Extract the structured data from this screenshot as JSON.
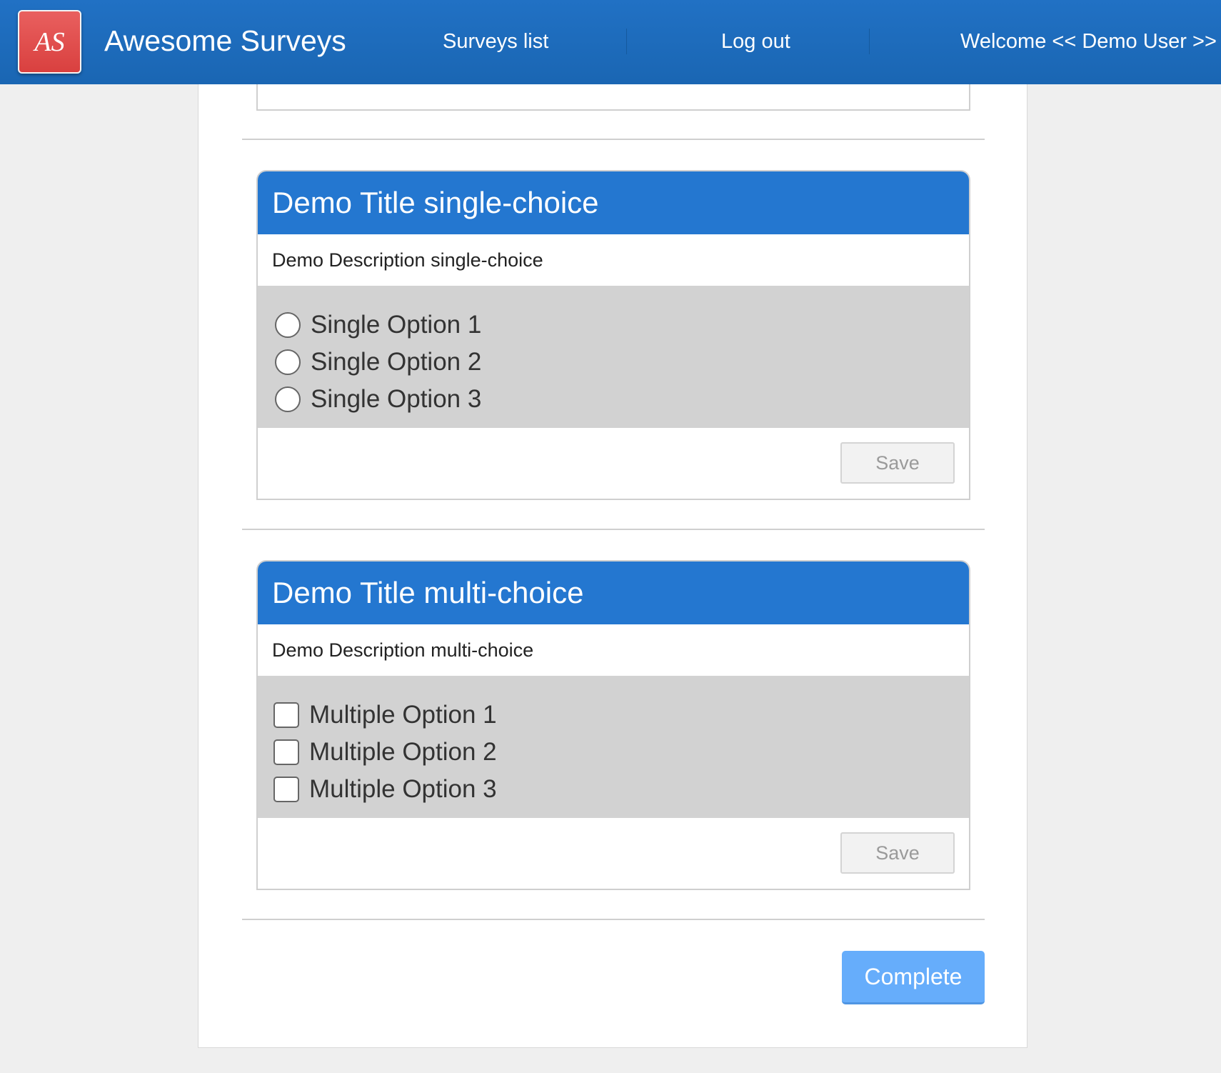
{
  "header": {
    "logo_text": "AS",
    "brand": "Awesome Surveys",
    "nav": {
      "surveys_list": "Surveys list",
      "log_out": "Log out",
      "welcome": "Welcome << Demo User >>"
    }
  },
  "colors": {
    "header_bg": "#1a66b3",
    "card_header_bg": "#2477d0",
    "logo_bg": "#d9403f",
    "complete_button_bg": "#66adfb"
  },
  "top_card": {
    "save_label": ""
  },
  "single_choice": {
    "title": "Demo Title single-choice",
    "description": "Demo Description single-choice",
    "options": [
      "Single Option 1",
      "Single Option 2",
      "Single Option 3"
    ],
    "save_label": "Save"
  },
  "multi_choice": {
    "title": "Demo Title multi-choice",
    "description": "Demo Description multi-choice",
    "options": [
      "Multiple Option 1",
      "Multiple Option 2",
      "Multiple Option 3"
    ],
    "save_label": "Save"
  },
  "complete_label": "Complete"
}
